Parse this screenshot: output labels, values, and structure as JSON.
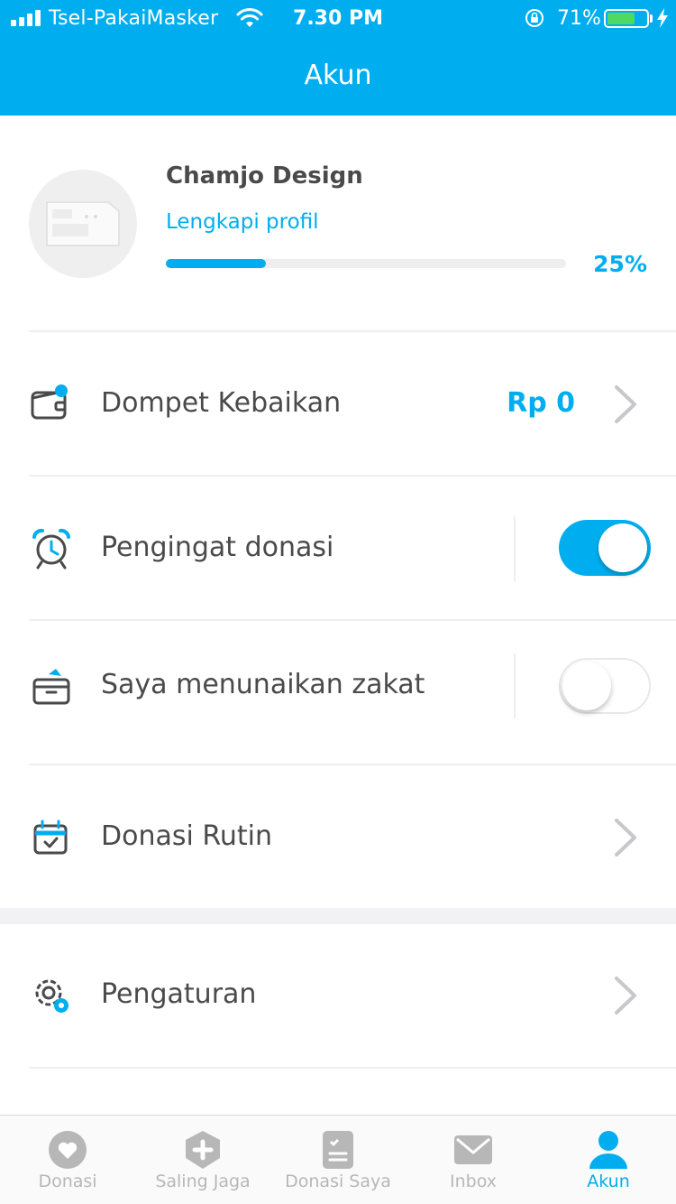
{
  "status_bar": {
    "carrier": "Tsel-PakaiMasker",
    "time": "7.30 PM",
    "battery_percent": "71%",
    "battery_level": 0.71
  },
  "header": {
    "title": "Akun"
  },
  "profile": {
    "name": "Chamjo Design",
    "complete_link": "Lengkapi profil",
    "progress_percent_text": "25%",
    "progress_value": 0.25
  },
  "menu": {
    "wallet": {
      "label": "Dompet Kebaikan",
      "value": "Rp 0",
      "icon": "wallet-icon"
    },
    "reminder": {
      "label": "Pengingat donasi",
      "toggle_on": true,
      "icon": "alarm-clock-icon"
    },
    "zakat": {
      "label": "Saya menunaikan zakat",
      "toggle_on": false,
      "icon": "zakat-box-icon"
    },
    "routine": {
      "label": "Donasi Rutin",
      "icon": "calendar-check-icon"
    },
    "settings": {
      "label": "Pengaturan",
      "icon": "gear-icon"
    }
  },
  "tabbar": {
    "items": [
      {
        "label": "Donasi",
        "icon": "heart-icon",
        "active": false
      },
      {
        "label": "Saling Jaga",
        "icon": "shield-plus-icon",
        "active": false
      },
      {
        "label": "Donasi Saya",
        "icon": "document-icon",
        "active": false
      },
      {
        "label": "Inbox",
        "icon": "envelope-icon",
        "active": false
      },
      {
        "label": "Akun",
        "icon": "user-icon",
        "active": true
      }
    ]
  },
  "colors": {
    "accent": "#00aeef",
    "text": "#4a4a4a",
    "muted": "#b7b7b7",
    "battery": "#4cd964"
  }
}
